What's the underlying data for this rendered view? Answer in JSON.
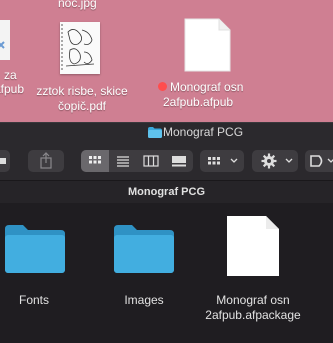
{
  "desktop": {
    "items": [
      {
        "label_line1": "za"
      },
      {
        "label_line1": "afpub"
      },
      {
        "label_line1": "zztok risbe, skice",
        "label_line2": "čopič.pdf"
      },
      {
        "label_line1": "Monograf osn",
        "label_line2": "2afpub.afpub"
      },
      {
        "label_line1": "noc.jpg"
      }
    ],
    "tag_color": "#ff4d4d"
  },
  "window": {
    "title": "Monograf PCG",
    "path_title": "Monograf PCG"
  },
  "files": [
    {
      "label_line1": "Fonts",
      "type": "folder"
    },
    {
      "label_line1": "Images",
      "type": "folder"
    },
    {
      "label_line1": "Monograf osn",
      "label_line2": "2afpub.afpackage",
      "type": "document"
    }
  ],
  "colors": {
    "folder": "#3aa8db",
    "folder_light": "#5fc2ec",
    "finder_bg": "#1f1d21"
  }
}
